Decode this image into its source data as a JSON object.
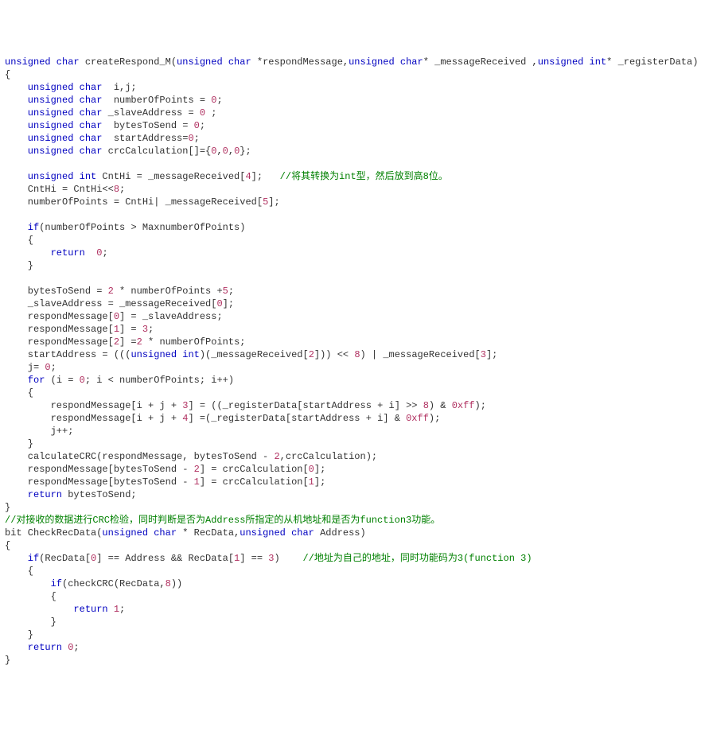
{
  "code": {
    "l01": {
      "a": "unsigned char",
      "b": " createRespond_M(",
      "c": "unsigned char",
      "d": " *respondMessage,",
      "e": "unsigned char",
      "f": "* _messageReceived ,",
      "g": "unsigned int",
      "h": "* _registerData)"
    },
    "l02": "{",
    "l03": {
      "a": "    unsigned char",
      "b": "  i,j;"
    },
    "l04": {
      "a": "    unsigned char",
      "b": "  numberOfPoints = ",
      "c": "0",
      "d": ";"
    },
    "l05": {
      "a": "    unsigned char",
      "b": " _slaveAddress = ",
      "c": "0",
      "d": " ;"
    },
    "l06": {
      "a": "    unsigned char",
      "b": "  bytesToSend = ",
      "c": "0",
      "d": ";"
    },
    "l07": {
      "a": "    unsigned char",
      "b": "  startAddress=",
      "c": "0",
      "d": ";"
    },
    "l08": {
      "a": "    unsigned char",
      "b": " crcCalculation[]={",
      "c": "0",
      "d": ",",
      "e": "0",
      "f": ",",
      "g": "0",
      "h": "};"
    },
    "l09": "",
    "l10": {
      "a": "    unsigned int",
      "b": " CntHi = _messageReceived[",
      "c": "4",
      "d": "];   ",
      "e": "//将其转换为int型，然后放到高8位。"
    },
    "l11": {
      "a": "    CntHi = CntHi<<",
      "b": "8",
      "c": ";"
    },
    "l12": {
      "a": "    numberOfPoints = CntHi| _messageReceived[",
      "b": "5",
      "c": "];"
    },
    "l13": "",
    "l14": {
      "a": "    if",
      "b": "(numberOfPoints > MaxnumberOfPoints)"
    },
    "l15": "    {",
    "l16": {
      "a": "        return",
      "b": "  ",
      "c": "0",
      "d": ";"
    },
    "l17": "    }",
    "l18": "",
    "l19": {
      "a": "    bytesToSend = ",
      "b": "2",
      "c": " * numberOfPoints +",
      "d": "5",
      "e": ";"
    },
    "l20": {
      "a": "    _slaveAddress = _messageReceived[",
      "b": "0",
      "c": "];"
    },
    "l21": {
      "a": "    respondMessage[",
      "b": "0",
      "c": "] = _slaveAddress;"
    },
    "l22": {
      "a": "    respondMessage[",
      "b": "1",
      "c": "] = ",
      "d": "3",
      "e": ";"
    },
    "l23": {
      "a": "    respondMessage[",
      "b": "2",
      "c": "] =",
      "d": "2",
      "e": " * numberOfPoints;"
    },
    "l24": {
      "a": "    startAddress = (((",
      "b": "unsigned int",
      "c": ")(_messageReceived[",
      "d": "2",
      "e": "])) << ",
      "f": "8",
      "g": ") | _messageReceived[",
      "h": "3",
      "i": "];"
    },
    "l25": {
      "a": "    j= ",
      "b": "0",
      "c": ";"
    },
    "l26": {
      "a": "    for",
      "b": " (i = ",
      "c": "0",
      "d": "; i < numberOfPoints; i++)"
    },
    "l27": "    {",
    "l28": {
      "a": "        respondMessage[i + j + ",
      "b": "3",
      "c": "] = ((_registerData[startAddress + i] >> ",
      "d": "8",
      "e": ") & ",
      "f": "0xff",
      "g": ");"
    },
    "l29": {
      "a": "        respondMessage[i + j + ",
      "b": "4",
      "c": "] =(_registerData[startAddress + i] & ",
      "d": "0xff",
      "e": ");"
    },
    "l30": "        j++;",
    "l31": "    }",
    "l32": {
      "a": "    calculateCRC(respondMessage, bytesToSend - ",
      "b": "2",
      "c": ",crcCalculation);"
    },
    "l33": {
      "a": "    respondMessage[bytesToSend - ",
      "b": "2",
      "c": "] = crcCalculation[",
      "d": "0",
      "e": "];"
    },
    "l34": {
      "a": "    respondMessage[bytesToSend - ",
      "b": "1",
      "c": "] = crcCalculation[",
      "d": "1",
      "e": "];"
    },
    "l35": {
      "a": "    return",
      "b": " bytesToSend;"
    },
    "l36": "}",
    "l37": "//对接收的数据进行CRC检验，同时判断是否为Address所指定的从机地址和是否为function3功能。",
    "l38": {
      "a": "bit CheckRecData(",
      "b": "unsigned char",
      "c": " * RecData,",
      "d": "unsigned char",
      "e": " Address)"
    },
    "l39": "{",
    "l40": {
      "a": "    if",
      "b": "(RecData[",
      "c": "0",
      "d": "] == Address && RecData[",
      "e": "1",
      "f": "] == ",
      "g": "3",
      "h": ")    ",
      "i": "//地址为自己的地址，同时功能码为3(function 3)"
    },
    "l41": "    {",
    "l42": {
      "a": "        if",
      "b": "(checkCRC(RecData,",
      "c": "8",
      "d": "))"
    },
    "l43": "        {",
    "l44": {
      "a": "            return",
      "b": " ",
      "c": "1",
      "d": ";"
    },
    "l45": "        }",
    "l46": "    }",
    "l47": {
      "a": "    return",
      "b": " ",
      "c": "0",
      "d": ";"
    },
    "l48": "}"
  }
}
